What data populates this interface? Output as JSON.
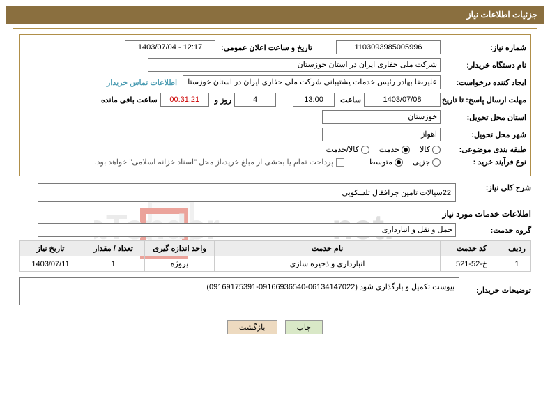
{
  "header": {
    "title": "جزئیات اطلاعات نیاز"
  },
  "fields": {
    "need_no_label": "شماره نیاز:",
    "need_no": "1103093985005996",
    "announce_label": "تاریخ و ساعت اعلان عمومی:",
    "announce": "1403/07/04 - 12:17",
    "buyer_org_label": "نام دستگاه خریدار:",
    "buyer_org": "شرکت ملی حفاری ایران در استان خوزستان",
    "requester_label": "ایجاد کننده درخواست:",
    "requester": "علیرضا بهادر رئیس خدمات پشتیبانی شرکت ملی حفاری ایران در استان خوزستا",
    "buyer_contact_link": "اطلاعات تماس خریدار",
    "deadline_label": "مهلت ارسال پاسخ: تا تاریخ:",
    "deadline_date": "1403/07/08",
    "time_label": "ساعت",
    "deadline_time": "13:00",
    "days": "4",
    "days_suffix": "روز و",
    "countdown": "00:31:21",
    "remaining_suffix": "ساعت باقی مانده",
    "province_label": "استان محل تحویل:",
    "province": "خوزستان",
    "city_label": "شهر محل تحویل:",
    "city": "اهواز",
    "subject_class_label": "طبقه بندی موضوعی:",
    "opt_goods": "کالا",
    "opt_service": "خدمت",
    "opt_goods_service": "کالا/خدمت",
    "buy_type_label": "نوع فرآیند خرید :",
    "opt_small": "جزیی",
    "opt_medium": "متوسط",
    "treasury_note": "پرداخت تمام یا بخشی از مبلغ خرید،از محل \"اسناد خزانه اسلامی\" خواهد بود."
  },
  "general_desc": {
    "label": "شرح کلی نیاز:",
    "text": "22سیالات تامین جرافقال تلسکوپی"
  },
  "services_section": {
    "title": "اطلاعات خدمات مورد نیاز",
    "group_label": "گروه خدمت:",
    "group_value": "حمل و نقل و انبارداری"
  },
  "table": {
    "headers": {
      "row": "ردیف",
      "code": "کد خدمت",
      "name": "نام خدمت",
      "unit": "واحد اندازه گیری",
      "qty": "تعداد / مقدار",
      "need_date": "تاریخ نیاز"
    },
    "rows": [
      {
        "row": "1",
        "code": "خ-52-521",
        "name": "انبارداری و ذخیره سازی",
        "unit": "پروژه",
        "qty": "1",
        "need_date": "1403/07/11"
      }
    ]
  },
  "notes": {
    "label": "توضیحات خریدار:",
    "text": "پیوست تکمیل و بارگذاری شود (06134147022-09166936540-09169175391)"
  },
  "buttons": {
    "print": "چاپ",
    "back": "بازگشت"
  }
}
